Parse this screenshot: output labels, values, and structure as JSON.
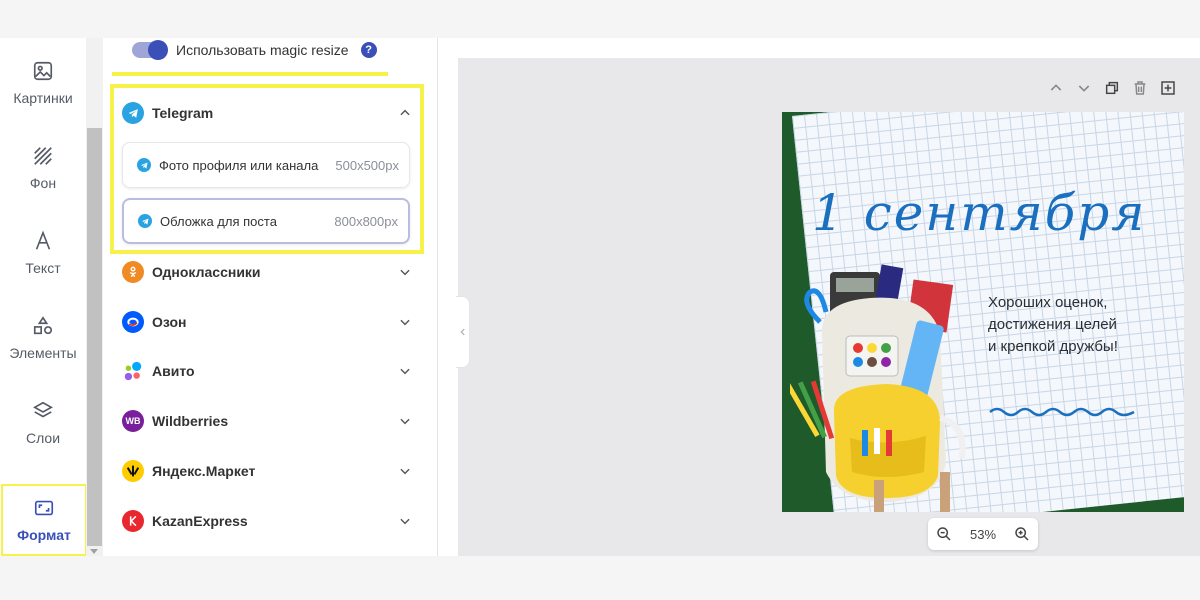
{
  "rail": {
    "items": [
      {
        "label": "Картинки",
        "icon": "image-icon"
      },
      {
        "label": "Фон",
        "icon": "background-pattern-icon"
      },
      {
        "label": "Текст",
        "icon": "text-icon"
      },
      {
        "label": "Элементы",
        "icon": "shapes-icon"
      },
      {
        "label": "Слои",
        "icon": "layers-icon"
      },
      {
        "label": "Формат",
        "icon": "resize-icon",
        "active": true
      }
    ]
  },
  "panel": {
    "magic_resize_label": "Использовать magic resize",
    "magic_resize_enabled": true,
    "help_glyph": "?",
    "groups": [
      {
        "name": "Telegram",
        "expanded": true,
        "color": "#2aa3e3",
        "items": [
          {
            "label": "Фото профиля или канала",
            "size": "500x500px",
            "selected": false
          },
          {
            "label": "Обложка для поста",
            "size": "800x800px",
            "selected": true
          }
        ]
      },
      {
        "name": "Одноклассники",
        "expanded": false,
        "color": "#f08a24"
      },
      {
        "name": "Озон",
        "expanded": false,
        "color": "#005bff"
      },
      {
        "name": "Авито",
        "expanded": false,
        "color": "#00aaff"
      },
      {
        "name": "Wildberries",
        "expanded": false,
        "color": "#7a1f9c",
        "logo_text": "WB"
      },
      {
        "name": "Яндекс.Маркет",
        "expanded": false,
        "color": "#ffcc00"
      },
      {
        "name": "KazanExpress",
        "expanded": false,
        "color": "#e8282e"
      }
    ]
  },
  "canvas": {
    "headline": "1 сентября",
    "wishes": [
      "Хороших оценок,",
      "достижения целей",
      "и крепкой дружбы!"
    ],
    "zoom": "53%",
    "colors": {
      "board_green": "#1f5a2a",
      "headline_blue": "#1a6fbf",
      "accent": "#3b4fb8",
      "highlight": "#f6f24a"
    }
  }
}
